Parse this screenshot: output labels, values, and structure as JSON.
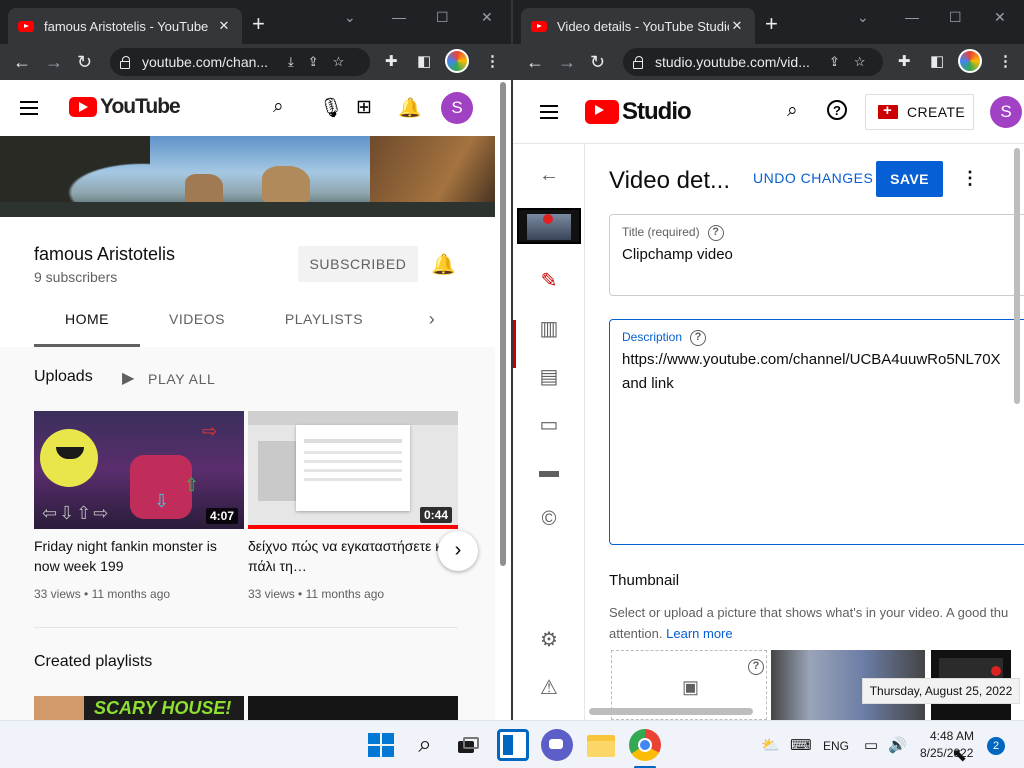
{
  "left_window": {
    "tab_title": "famous Aristotelis - YouTube",
    "url": "youtube.com/chan...",
    "page": {
      "logo_text": "YouTube",
      "avatar_letter": "S",
      "channel": {
        "name": "famous Aristotelis",
        "subscribers": "9 subscribers",
        "subscribe_label": "SUBSCRIBED"
      },
      "tabs": [
        "HOME",
        "VIDEOS",
        "PLAYLISTS"
      ],
      "uploads": {
        "title": "Uploads",
        "play_all": "PLAY ALL",
        "videos": [
          {
            "title": "Friday night fankin monster is now week 199",
            "duration": "4:07",
            "views": "33 views",
            "age": "11 months ago"
          },
          {
            "title": "δείχνο πώς να εγκαταστήσετε και πάλι τη…",
            "duration": "0:44",
            "views": "33 views",
            "age": "11 months ago"
          }
        ]
      },
      "playlists": {
        "title": "Created playlists"
      }
    }
  },
  "right_window": {
    "tab_title": "Video details - YouTube Studio",
    "url": "studio.youtube.com/vid...",
    "page": {
      "logo_text": "Studio",
      "create_label": "CREATE",
      "avatar_letter": "S",
      "heading": "Video det...",
      "undo_label": "UNDO CHANGES",
      "save_label": "SAVE",
      "title_field": {
        "label": "Title (required)",
        "value": "Clipchamp video"
      },
      "description_field": {
        "label": "Description",
        "value": "https://www.youtube.com/channel/UCBA4uuwRo5NL70X\nand link"
      },
      "thumbnail": {
        "title": "Thumbnail",
        "description": "Select or upload a picture that shows what's in your video. A good thu",
        "description2": "attention.",
        "learn_more": "Learn more"
      }
    }
  },
  "taskbar": {
    "language": "ENG",
    "time": "4:48 AM",
    "date": "8/25/2022",
    "notification_count": "2",
    "tooltip": "Thursday, August 25, 2022"
  },
  "colors": {
    "youtube_red": "#ff0000",
    "studio_blue": "#065fd4",
    "chrome_dark": "#202124",
    "avatar_purple": "#a142c4"
  }
}
